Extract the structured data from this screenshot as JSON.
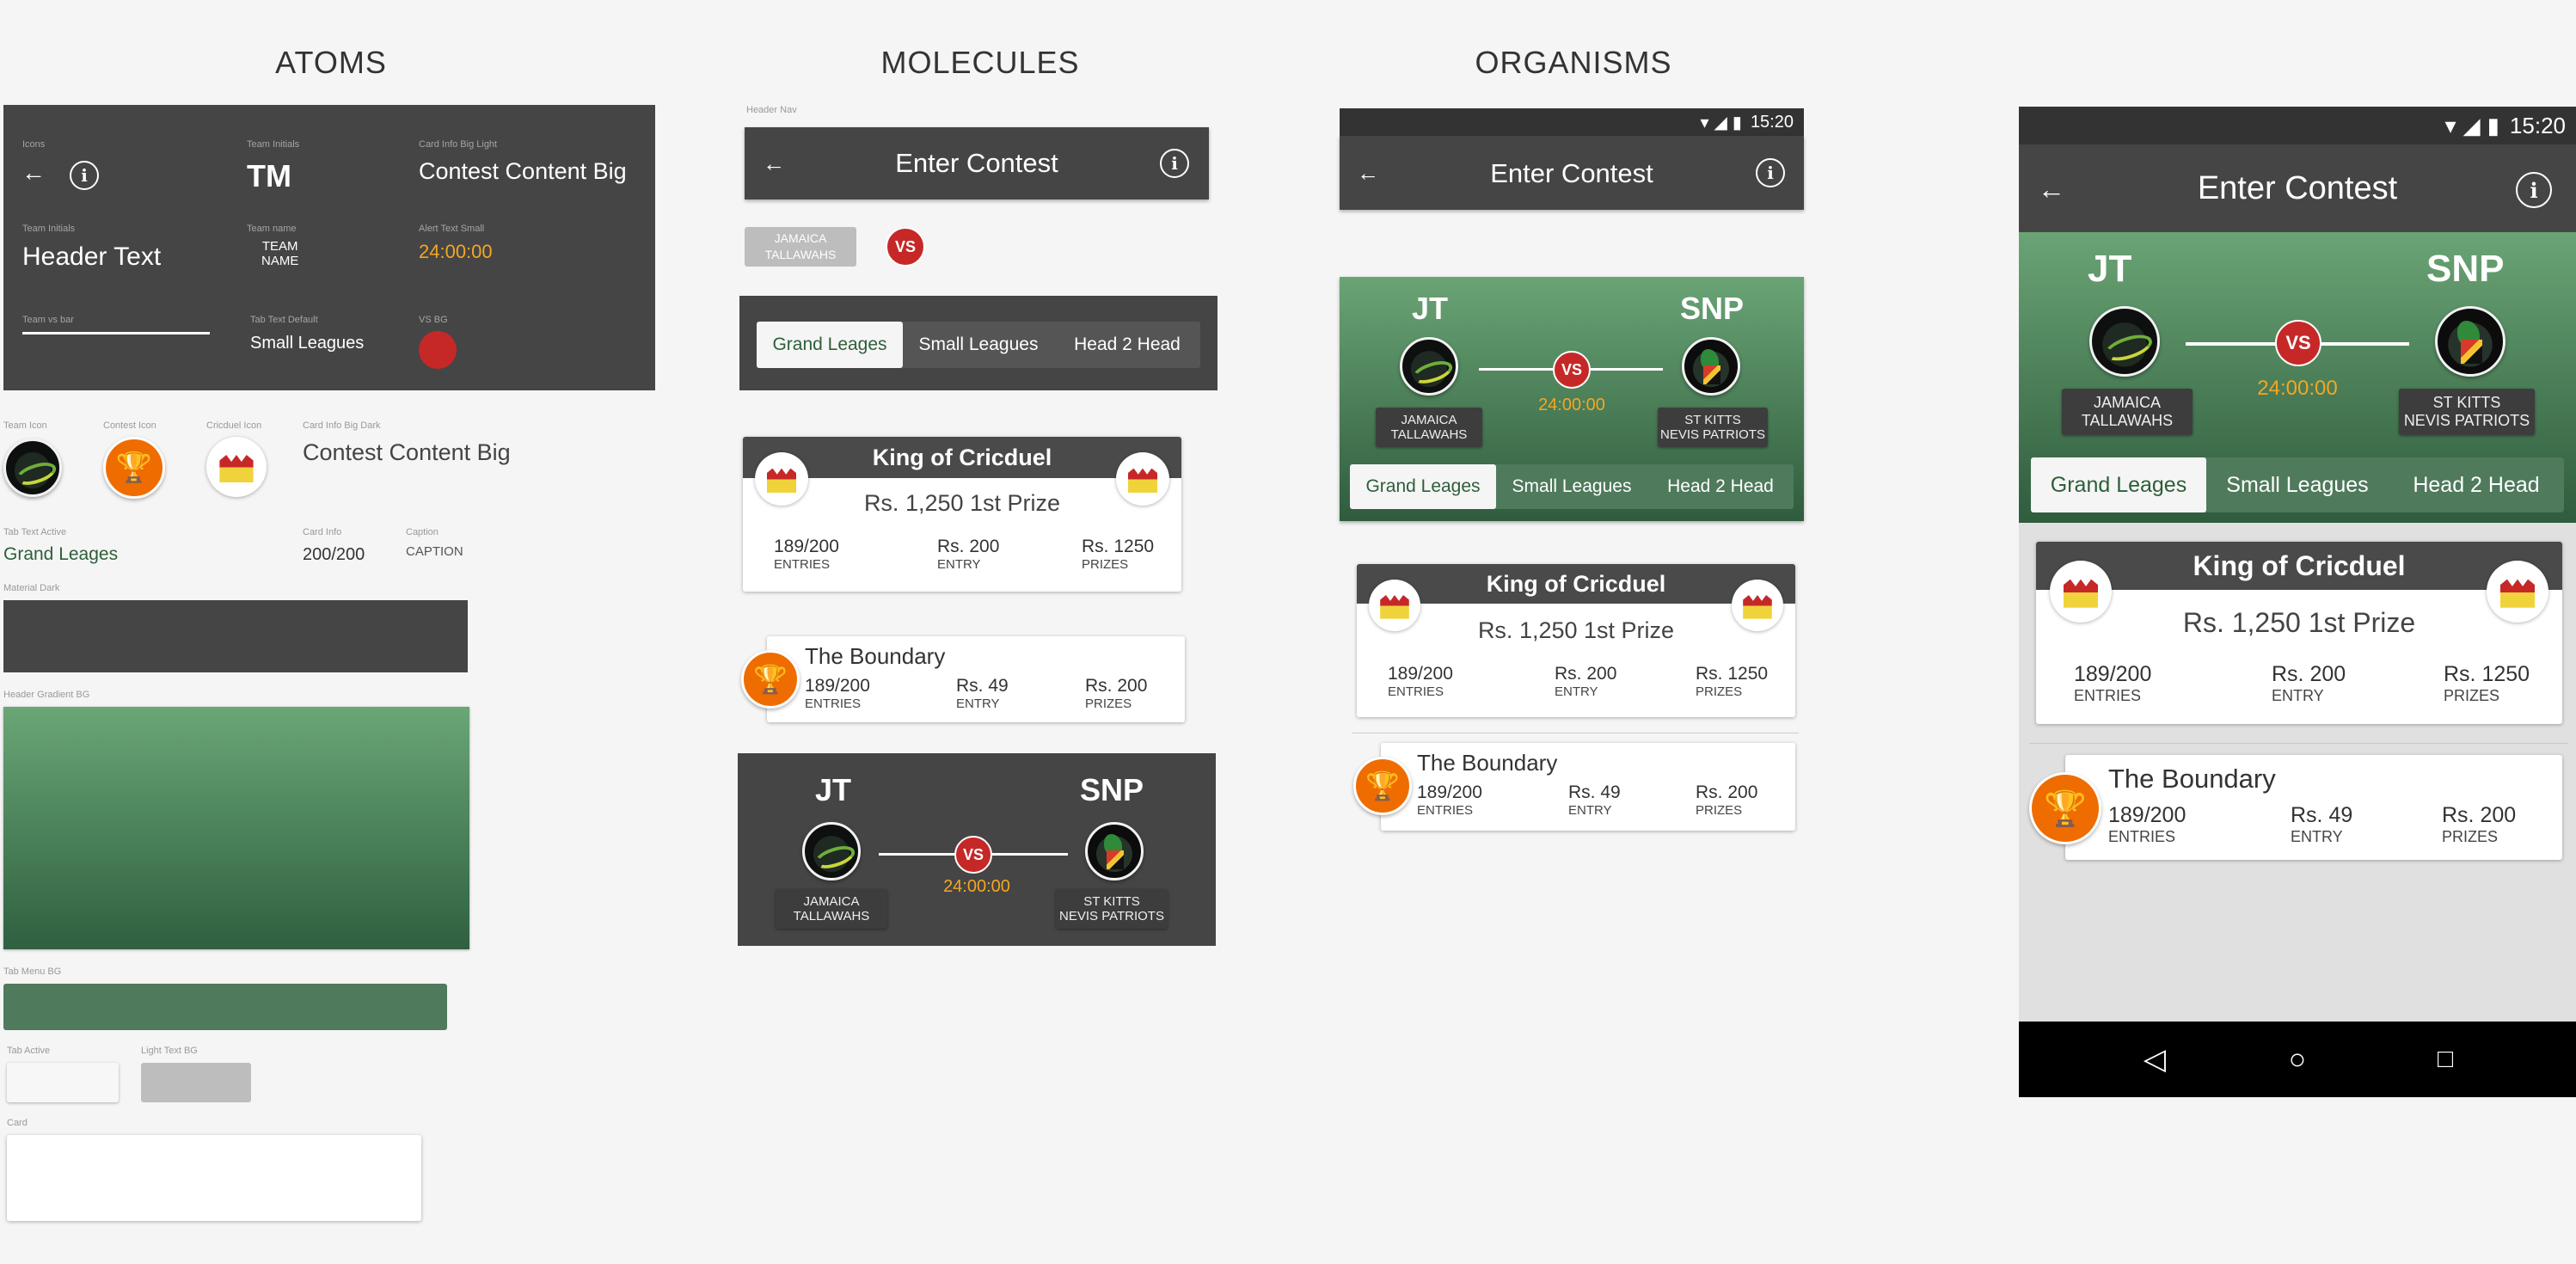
{
  "sections": {
    "atoms": "ATOMS",
    "molecules": "MOLECULES",
    "organisms": "ORGANISMS"
  },
  "atoms": {
    "icons_lbl": "Icons",
    "team_initials_lbl": "Team Initials",
    "team_initials": "TM",
    "card_big_light_lbl": "Card Info Big Light",
    "card_big_light": "Contest Content Big",
    "team_initials_lbl2": "Team Initials",
    "header_text": "Header Text",
    "team_name_lbl": "Team name",
    "team_name": "TEAM\nNAME",
    "alert_lbl": "Alert Text Small",
    "alert": "24:00:00",
    "vsbar_lbl": "Team vs bar",
    "tab_default_lbl": "Tab Text Default",
    "tab_default": "Small Leagues",
    "vsbg_lbl": "VS BG",
    "team_icon_lbl": "Team Icon",
    "contest_icon_lbl": "Contest Icon",
    "cricduel_icon_lbl": "Cricduel Icon",
    "card_big_dark_lbl": "Card Info Big Dark",
    "card_big_dark": "Contest Content Big",
    "tab_active_lbl": "Tab Text Active",
    "tab_active": "Grand Leages",
    "card_info_lbl": "Card Info",
    "card_info": "200/200",
    "caption_lbl": "Caption",
    "caption": "CAPTION",
    "material_dark_lbl": "Material Dark",
    "header_gradient_lbl": "Header Gradient BG",
    "tab_menu_lbl": "Tab Menu BG",
    "tab_active_bg_lbl": "Tab Active",
    "light_text_bg_lbl": "Light Text BG",
    "card_lbl": "Card"
  },
  "molecules": {
    "header_nav_lbl": "Header Nav",
    "header_title": "Enter Contest",
    "team_chip": "JAMAICA\nTALLAWAHS",
    "vs": "VS",
    "tabs": [
      "Grand Leages",
      "Small Leagues",
      "Head 2 Head"
    ],
    "king": {
      "title": "King of Cricduel",
      "prize": "Rs. 1,250 1st Prize",
      "stats": [
        {
          "v": "189/200",
          "c": "ENTRIES"
        },
        {
          "v": "Rs. 200",
          "c": "ENTRY"
        },
        {
          "v": "Rs. 1250",
          "c": "PRIZES"
        }
      ]
    },
    "boundary": {
      "title": "The Boundary",
      "stats": [
        {
          "v": "189/200",
          "c": "ENTRIES"
        },
        {
          "v": "Rs. 49",
          "c": "ENTRY"
        },
        {
          "v": "Rs. 200",
          "c": "PRIZES"
        }
      ]
    },
    "match": {
      "team1": "JT",
      "team2": "SNP",
      "team1_name": "JAMAICA\nTALLAWAHS",
      "team2_name": "ST KITTS\nNEVIS PATRIOTS",
      "time": "24:00:00"
    }
  },
  "organism": {
    "time": "15:20",
    "header_title": "Enter Contest"
  },
  "colors": {
    "dark": "#454545",
    "accent": "#f5a623",
    "green": "#4f7a5c",
    "vs": "#c62828",
    "trophy": "#ef6c00"
  }
}
